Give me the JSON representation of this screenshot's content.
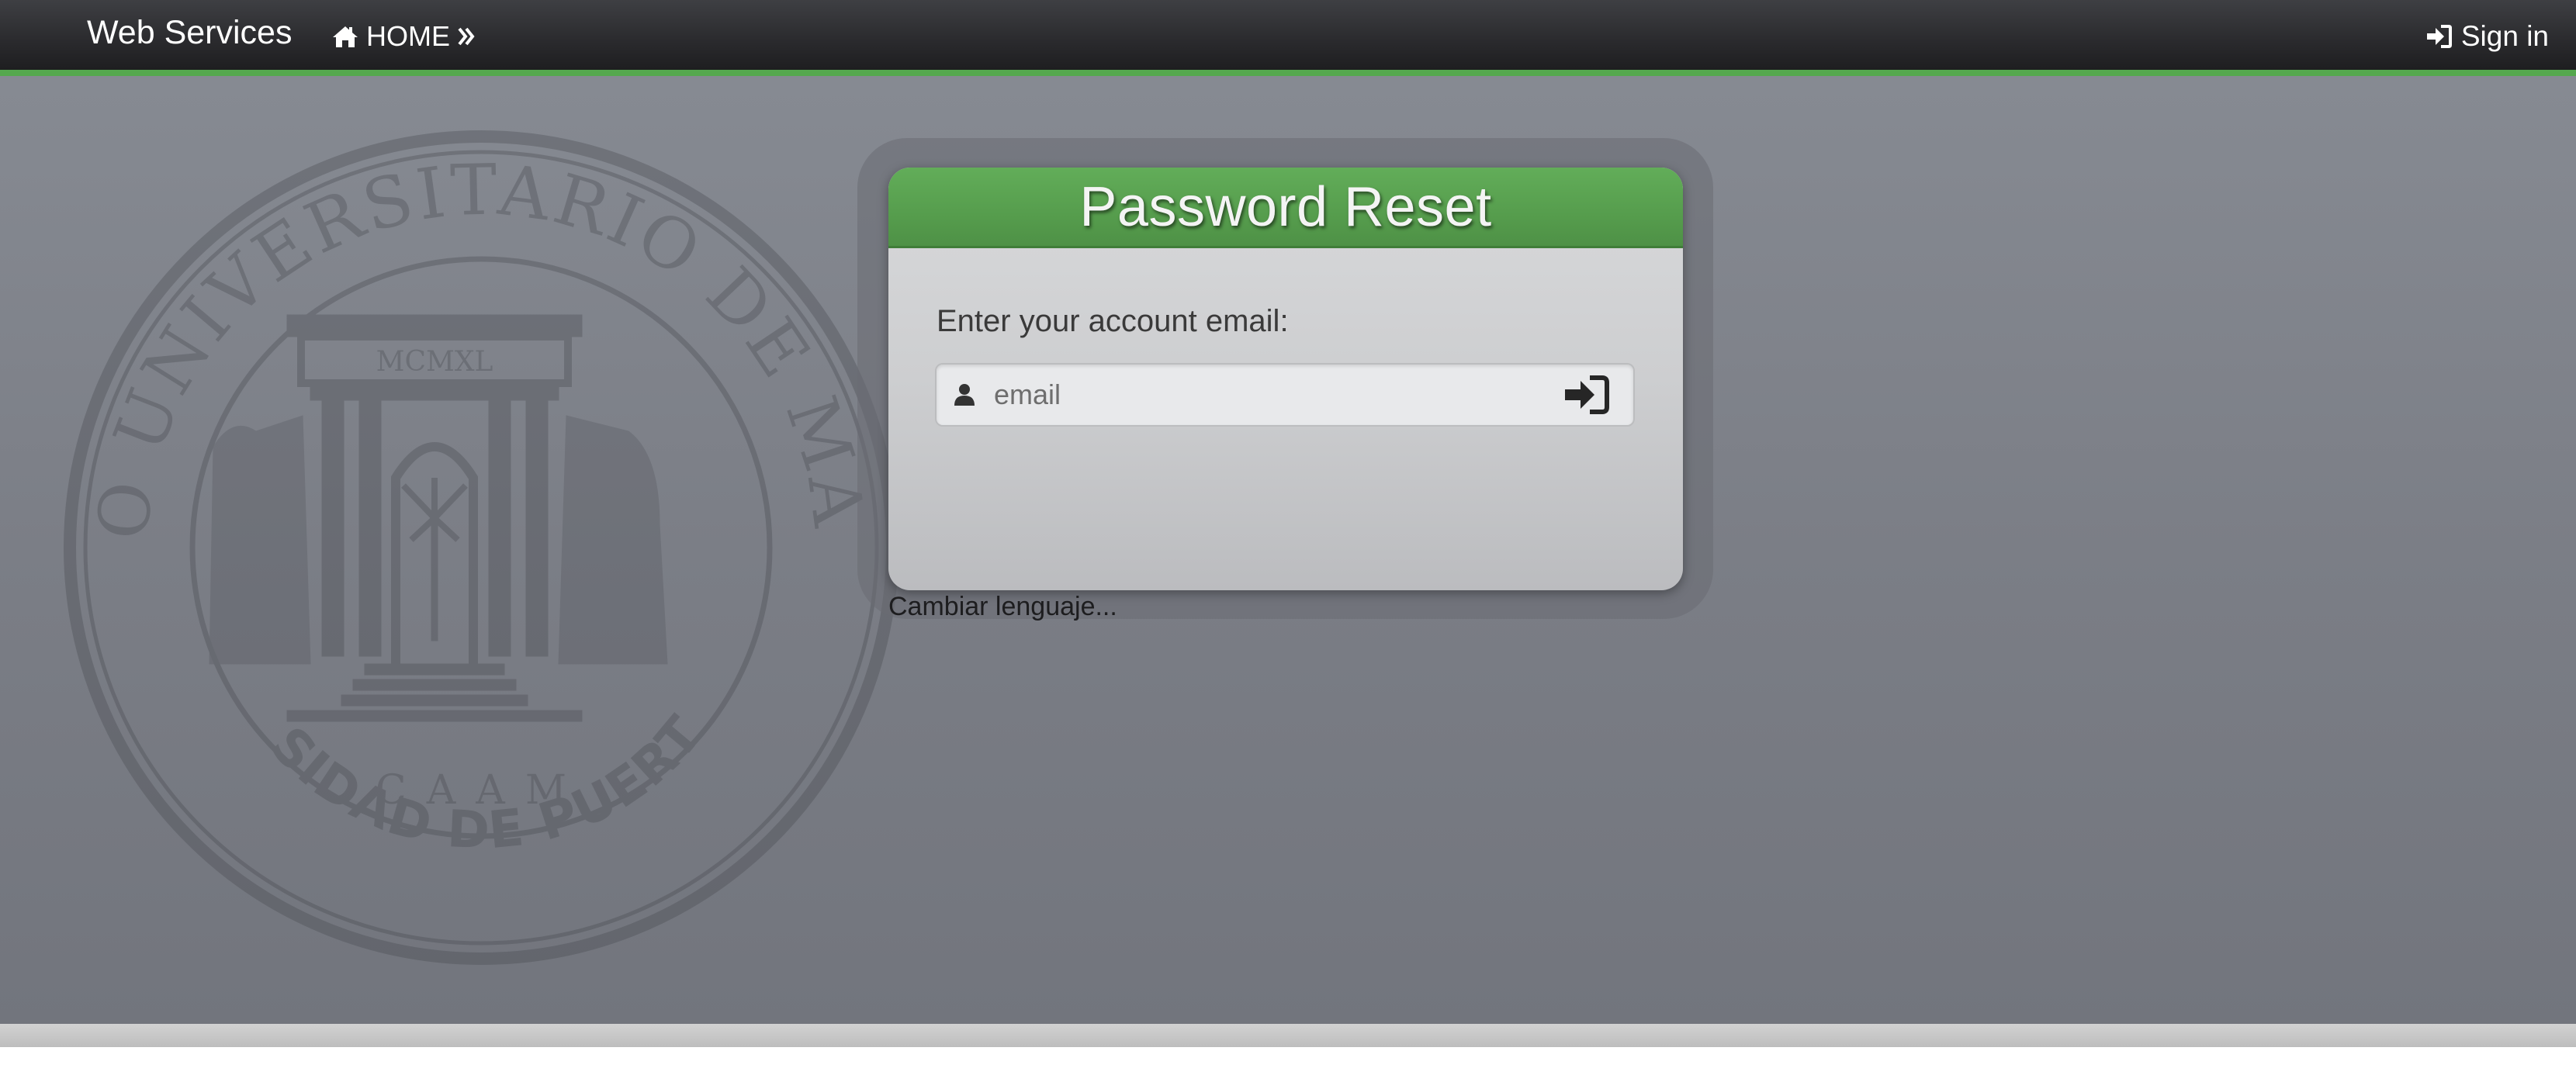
{
  "navbar": {
    "brand": "Web Services",
    "home_label": "HOME",
    "home_icon": "home-icon",
    "home_chevron_icon": "double-chevron-right-icon",
    "signin_label": "Sign in",
    "signin_icon": "sign-in-icon",
    "accent_color": "#55a84e"
  },
  "background": {
    "seal": {
      "top_text": "RECINTO UNIVERSITARIO DE MAYAGUEZ",
      "bottom_text": "UNIVERSIDAD DE PUERTO RICO",
      "inner_text": "CAAM",
      "monument_text": "MCMXL"
    }
  },
  "panel": {
    "title": "Password Reset",
    "prompt": "Enter your account email:",
    "email": {
      "value": "",
      "placeholder": "email",
      "icon": "user-icon"
    },
    "submit_icon": "sign-in-icon",
    "header_color": "#5aa451"
  },
  "language_link": "Cambiar lenguaje..."
}
